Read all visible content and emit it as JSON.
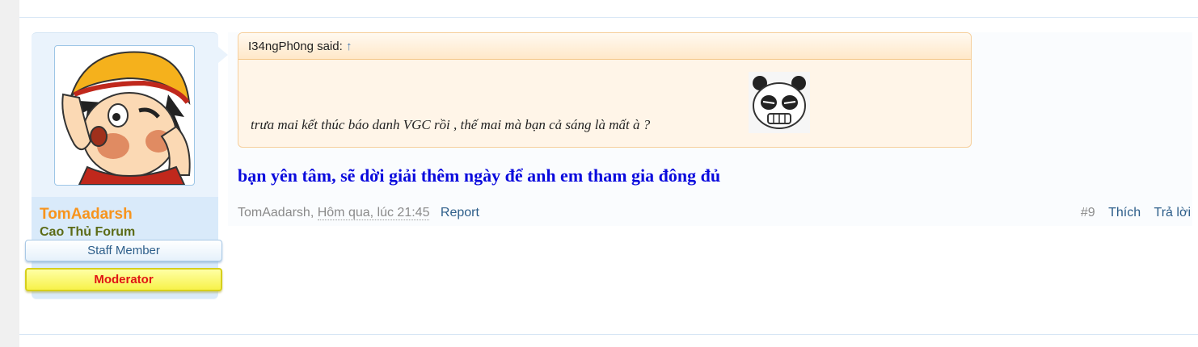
{
  "user": {
    "name": "TomAadarsh",
    "title": "Cao Thủ Forum",
    "badges": [
      "Staff Member",
      "Moderator"
    ]
  },
  "quote": {
    "author_said": "I34ngPh0ng said:",
    "arrow": "↑",
    "text": "trưa mai kết thúc báo danh VGC rồi , thế mai mà bạn cả sáng là mất à ?"
  },
  "post": {
    "text": "bạn yên tâm, sẽ dời giải thêm ngày để anh em tham gia đông đủ"
  },
  "meta": {
    "author": "TomAadarsh,",
    "date": "Hôm qua, lúc 21:45",
    "report": "Report",
    "number": "#9",
    "like": "Thích",
    "reply": "Trả lời"
  },
  "colors": {
    "username": "#f7941d",
    "usertitle": "#5c6b17",
    "moderator": "#e01414",
    "post_text": "#0a0add",
    "link": "#2d5e8a"
  }
}
